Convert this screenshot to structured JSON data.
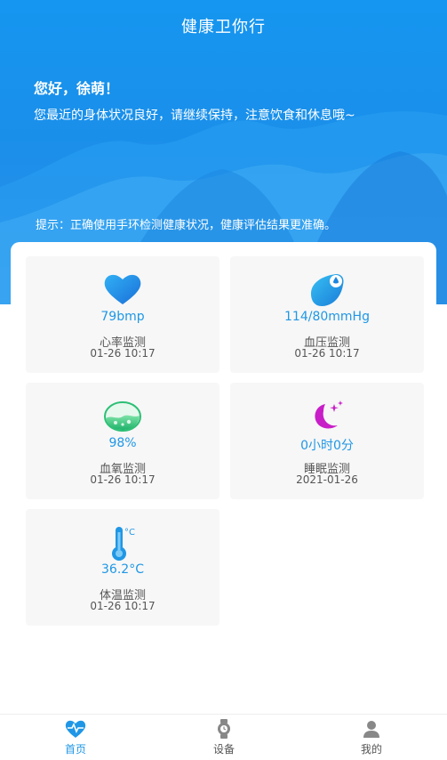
{
  "header": {
    "title": "健康卫你行",
    "greeting": "您好，徐萌！",
    "message": "您最近的身体状况良好，请继续保持，注意饮食和休息哦~",
    "tip": "提示：正确使用手环检测健康状况，健康评估结果更准确。"
  },
  "cards": [
    {
      "value": "79bmp",
      "name": "心率监测",
      "time": "01-26 10:17",
      "icon": "heart-icon"
    },
    {
      "value": "114/80mmHg",
      "name": "血压监测",
      "time": "01-26 10:17",
      "icon": "blood-drop-icon"
    },
    {
      "value": "98%",
      "name": "血氧监测",
      "time": "01-26 10:17",
      "icon": "oxygen-flask-icon"
    },
    {
      "value": "0小时0分",
      "name": "睡眠监测",
      "time": "2021-01-26",
      "icon": "moon-stars-icon"
    },
    {
      "value": "36.2°C",
      "name": "体温监测",
      "time": "01-26 10:17",
      "icon": "thermometer-icon"
    }
  ],
  "tabbar": {
    "items": [
      {
        "label": "首页",
        "icon": "heartbeat-icon",
        "active": true
      },
      {
        "label": "设备",
        "icon": "watch-icon",
        "active": false
      },
      {
        "label": "我的",
        "icon": "user-icon",
        "active": false
      }
    ]
  },
  "colors": {
    "primary": "#1f97e6",
    "hero_bg": "#1596f0",
    "card_bg": "#f7f7f7",
    "sleep_purple": "#c81ec8"
  }
}
